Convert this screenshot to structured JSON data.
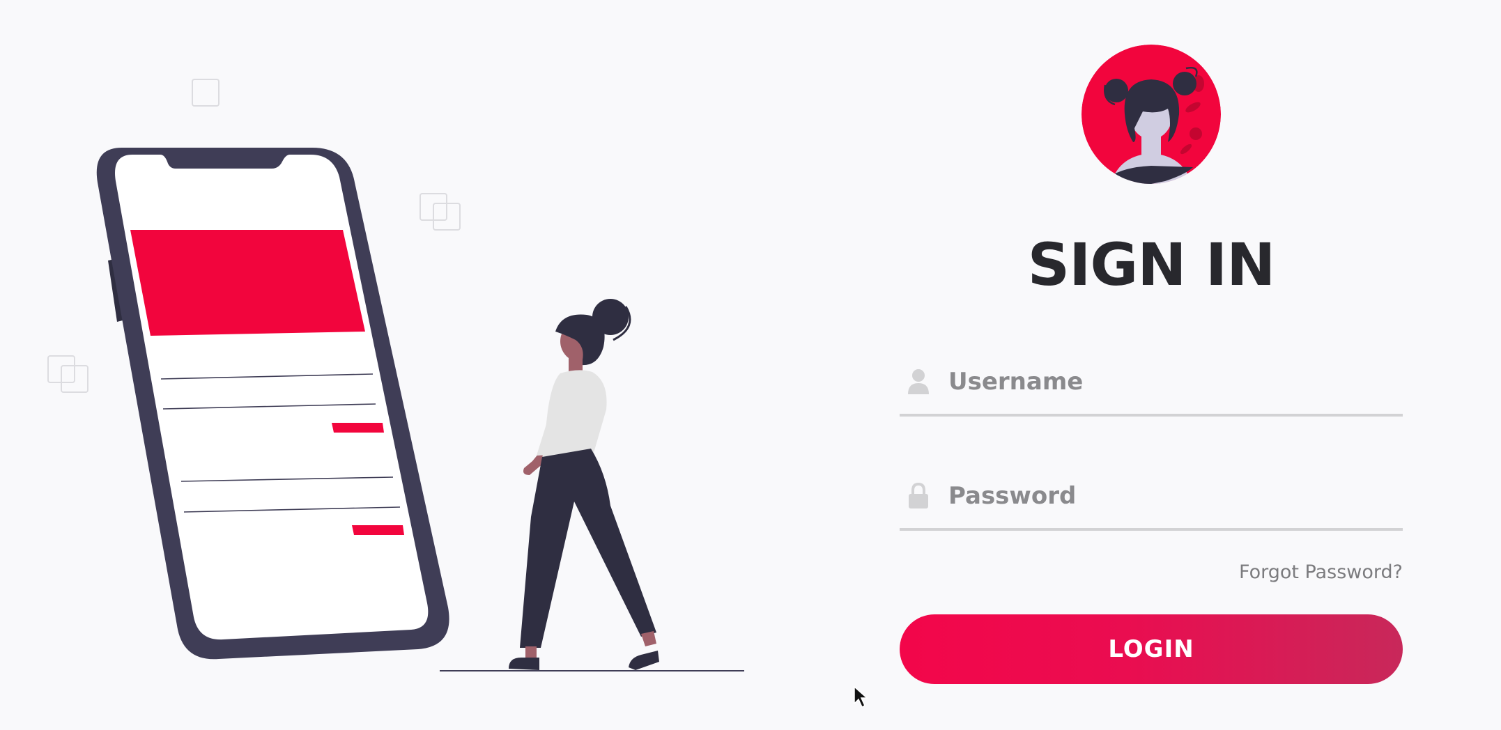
{
  "form": {
    "title": "SIGN IN",
    "username_placeholder": "Username",
    "password_placeholder": "Password",
    "forgot_label": "Forgot Password?",
    "login_label": "LOGIN"
  },
  "colors": {
    "accent": "#f3064a",
    "accent_end": "#c8285a",
    "dark": "#2f2e41",
    "background": "#f9f9fb"
  },
  "icons": {
    "username": "user-icon",
    "password": "lock-icon"
  }
}
